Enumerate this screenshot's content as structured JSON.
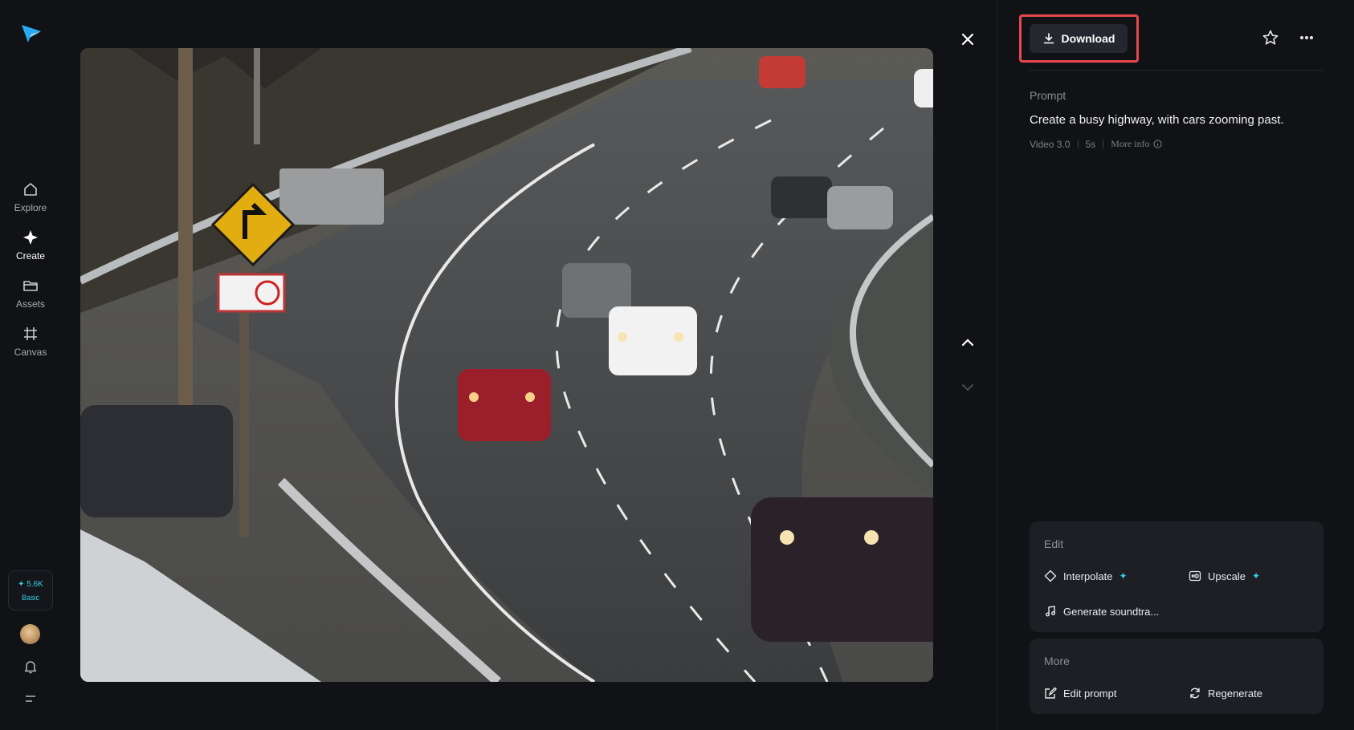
{
  "sidebar": {
    "logo_icon": "paper-plane-logo",
    "items": [
      {
        "label": "Explore",
        "icon": "home-icon",
        "active": false
      },
      {
        "label": "Create",
        "icon": "sparkle-icon",
        "active": true
      },
      {
        "label": "Assets",
        "icon": "folder-icon",
        "active": false
      },
      {
        "label": "Canvas",
        "icon": "crop-grid-icon",
        "active": false
      }
    ],
    "credits": {
      "amount": "✦ 5.6K",
      "plan": "Basic"
    }
  },
  "viewer": {
    "image_alt": "busy highway with cars"
  },
  "toolbar": {
    "download_label": "Download"
  },
  "details": {
    "prompt_label": "Prompt",
    "prompt_text": "Create a busy highway, with cars zooming past.",
    "model": "Video 3.0",
    "duration": "5s",
    "more_info": "More info"
  },
  "edit_section": {
    "title": "Edit",
    "actions": [
      {
        "label": "Interpolate",
        "icon": "diamond-icon",
        "premium": true
      },
      {
        "label": "Upscale",
        "icon": "hd-icon",
        "premium": true
      },
      {
        "label": "Generate soundtra...",
        "icon": "music-note-icon",
        "premium": false
      }
    ]
  },
  "more_section": {
    "title": "More",
    "actions": [
      {
        "label": "Edit prompt",
        "icon": "edit-icon"
      },
      {
        "label": "Regenerate",
        "icon": "refresh-icon"
      }
    ]
  },
  "colors": {
    "background": "#111216",
    "accent": "#2fd0e6",
    "highlight": "#e5484d",
    "card": "#1d1f25"
  }
}
